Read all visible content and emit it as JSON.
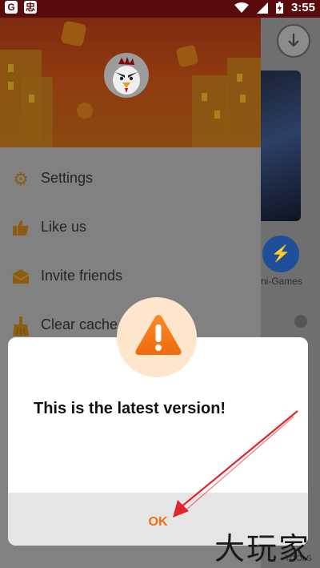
{
  "status_bar": {
    "left_icons": [
      "notification-icon",
      "app-icon"
    ],
    "right_icons": [
      "wifi-icon",
      "signal-icon",
      "battery-icon"
    ],
    "time": "3:55"
  },
  "drawer": {
    "menu": [
      {
        "label": "Settings",
        "icon": "gear-icon"
      },
      {
        "label": "Like us",
        "icon": "thumbs-up-icon"
      },
      {
        "label": "Invite friends",
        "icon": "envelope-icon"
      },
      {
        "label": "Clear cache",
        "icon": "broom-icon"
      }
    ]
  },
  "background_app": {
    "mini_games_label": "ni-Games",
    "tools_label": "TOOLS"
  },
  "dialog": {
    "message": "This is the latest version!",
    "ok_label": "OK",
    "icon": "warning-icon"
  },
  "watermark": "大玩家",
  "colors": {
    "accent": "#ee6f12",
    "warning_circle": "#fde6cb",
    "status_bar": "#5a0b0d"
  }
}
